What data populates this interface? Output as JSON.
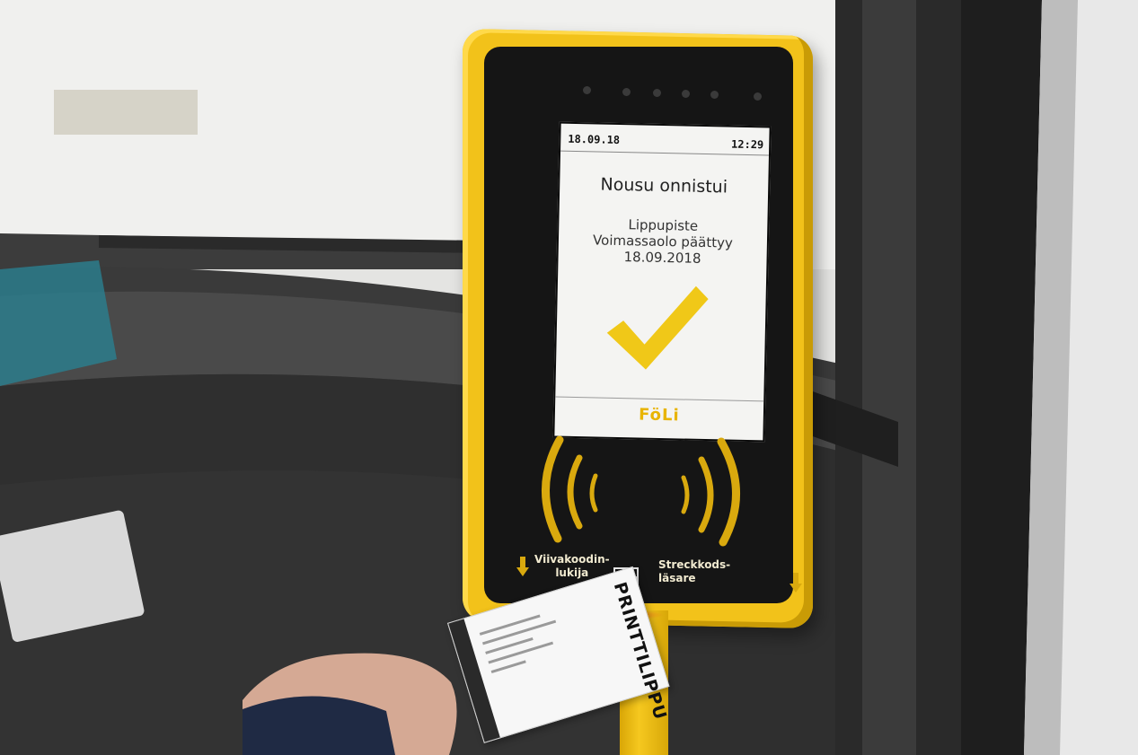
{
  "reader": {
    "screen": {
      "date": "18.09.18",
      "time": "12:29",
      "headline": "Nousu onnistui",
      "ticket_type": "Lippupiste",
      "validity_label": "Voimassaolo päättyy",
      "validity_date": "18.09.2018",
      "logo": "FöLi"
    },
    "scanner": {
      "label_fi": "Viivakoodin-\nlukija",
      "label_sv": "Streckkods-\nläsare"
    }
  },
  "ticket": {
    "brand": "PRINTTILIPPU"
  },
  "colors": {
    "reader_yellow": "#f2c21a",
    "reader_face": "#151515",
    "screen_bg": "#f4f4f2",
    "check_yellow": "#f0c818",
    "laser_red": "#ff3c28"
  },
  "icons": [
    "checkmark-icon",
    "nfc-waves-icon",
    "qr-code-icon",
    "arrow-down-icon"
  ]
}
